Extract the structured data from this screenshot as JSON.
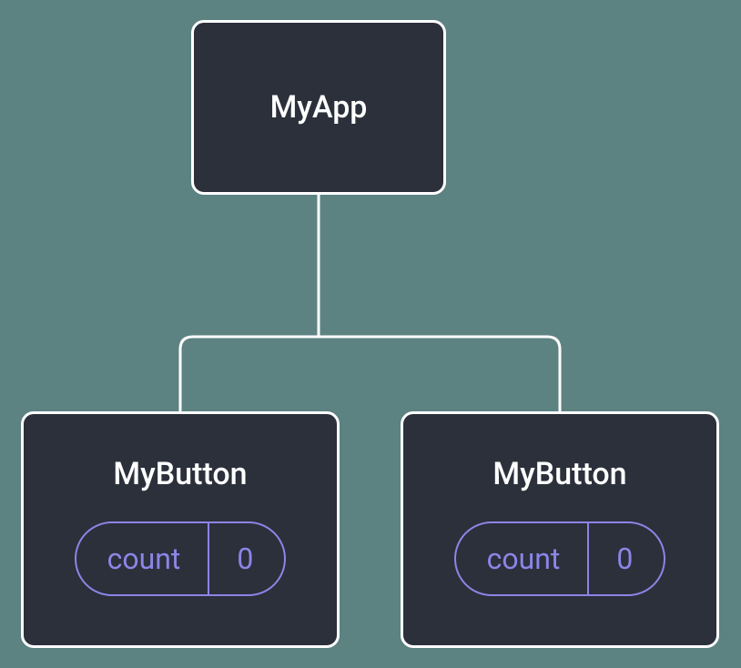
{
  "root": {
    "label": "MyApp"
  },
  "children": [
    {
      "label": "MyButton",
      "state": {
        "name": "count",
        "value": "0"
      }
    },
    {
      "label": "MyButton",
      "state": {
        "name": "count",
        "value": "0"
      }
    }
  ],
  "colors": {
    "background": "#5d8282",
    "node_bg": "#2b303b",
    "node_border": "#ffffff",
    "pill_border": "#8b86e6",
    "text": "#ffffff"
  }
}
